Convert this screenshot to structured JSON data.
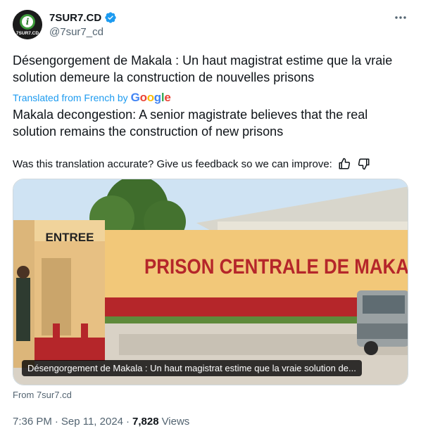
{
  "author": {
    "display_name": "7SUR7.CD",
    "handle": "@7sur7_cd",
    "avatar_label": "7SUR7.CD"
  },
  "tweet": {
    "original_text": "Désengorgement de Makala : Un haut magistrat estime que la vraie solution demeure la construction de nouvelles prisons",
    "translated_by_label": "Translated from French by",
    "translator_brand": "Google",
    "translated_text": "Makala decongestion: A senior magistrate believes that the real solution remains the construction of new prisons",
    "feedback_prompt": "Was this translation accurate? Give us feedback so we can improve:"
  },
  "media": {
    "sign_entree": "ENTREE",
    "sign_prison": "PRISON CENTRALE DE MAKA",
    "card_caption": "Désengorgement de Makala : Un haut magistrat estime que la vraie solution de..."
  },
  "source": "From 7sur7.cd",
  "meta": {
    "time": "7:36 PM",
    "separator": "·",
    "date": "Sep 11, 2024",
    "views_count": "7,828",
    "views_label": "Views"
  },
  "colors": {
    "accent": "#1d9bf0",
    "muted": "#536471",
    "prison_red": "#b5262a"
  },
  "icons": [
    "verified-badge-icon",
    "more-options-icon",
    "thumbs-up-icon",
    "thumbs-down-icon"
  ]
}
